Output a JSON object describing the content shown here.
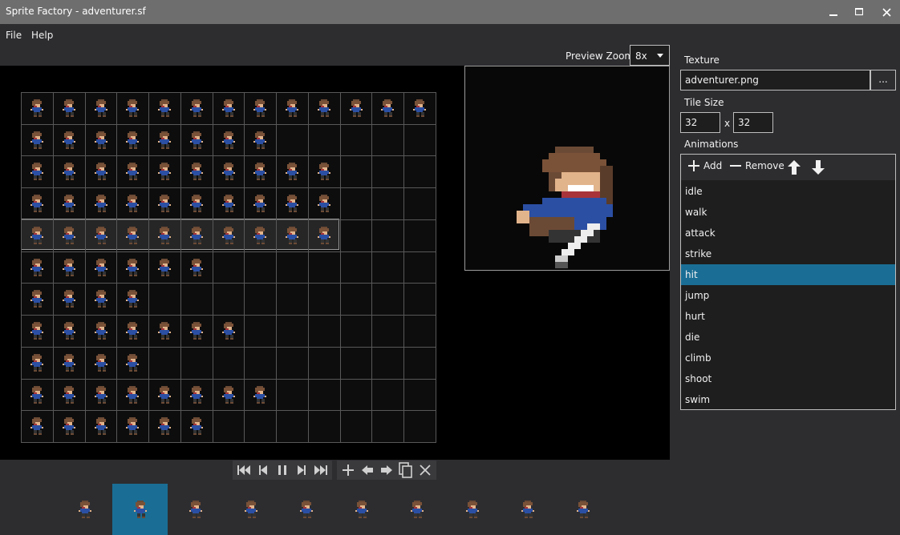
{
  "window": {
    "title": "Sprite Factory - adventurer.sf",
    "minimize_icon": "minimize-icon",
    "maximize_icon": "maximize-icon",
    "close_icon": "close-icon"
  },
  "menu": {
    "items": [
      "File",
      "Help"
    ]
  },
  "preview_zoom": {
    "label": "Preview Zoom",
    "value": "8x"
  },
  "sprite_sheet": {
    "columns": 13,
    "rows": 11,
    "row_frame_counts": [
      13,
      8,
      10,
      10,
      10,
      6,
      4,
      7,
      4,
      8,
      6
    ],
    "highlighted_row": 4
  },
  "playback": {
    "buttons": [
      "first-frame-icon",
      "previous-frame-icon",
      "pause-icon",
      "next-frame-icon",
      "last-frame-icon"
    ],
    "edit_buttons": [
      "plus-icon",
      "arrow-left-icon",
      "arrow-right-icon",
      "copy-icon",
      "close-icon"
    ]
  },
  "frames": {
    "count": 10,
    "selected_index": 1
  },
  "panel": {
    "texture_label": "Texture",
    "texture_value": "adventurer.png",
    "browse_label": "...",
    "tile_size_label": "Tile Size",
    "tile_width": "32",
    "tile_height": "32",
    "tile_separator": "x",
    "animations_label": "Animations",
    "add_label": "Add",
    "remove_label": "Remove"
  },
  "animations": {
    "items": [
      "idle",
      "walk",
      "attack",
      "strike",
      "hit",
      "jump",
      "hurt",
      "die",
      "climb",
      "shoot",
      "swim"
    ],
    "selected": "hit"
  },
  "colors": {
    "accent": "#1a6e95",
    "titlebar": "#6e6e6e",
    "background": "#2d2d30",
    "canvas": "#000000"
  }
}
